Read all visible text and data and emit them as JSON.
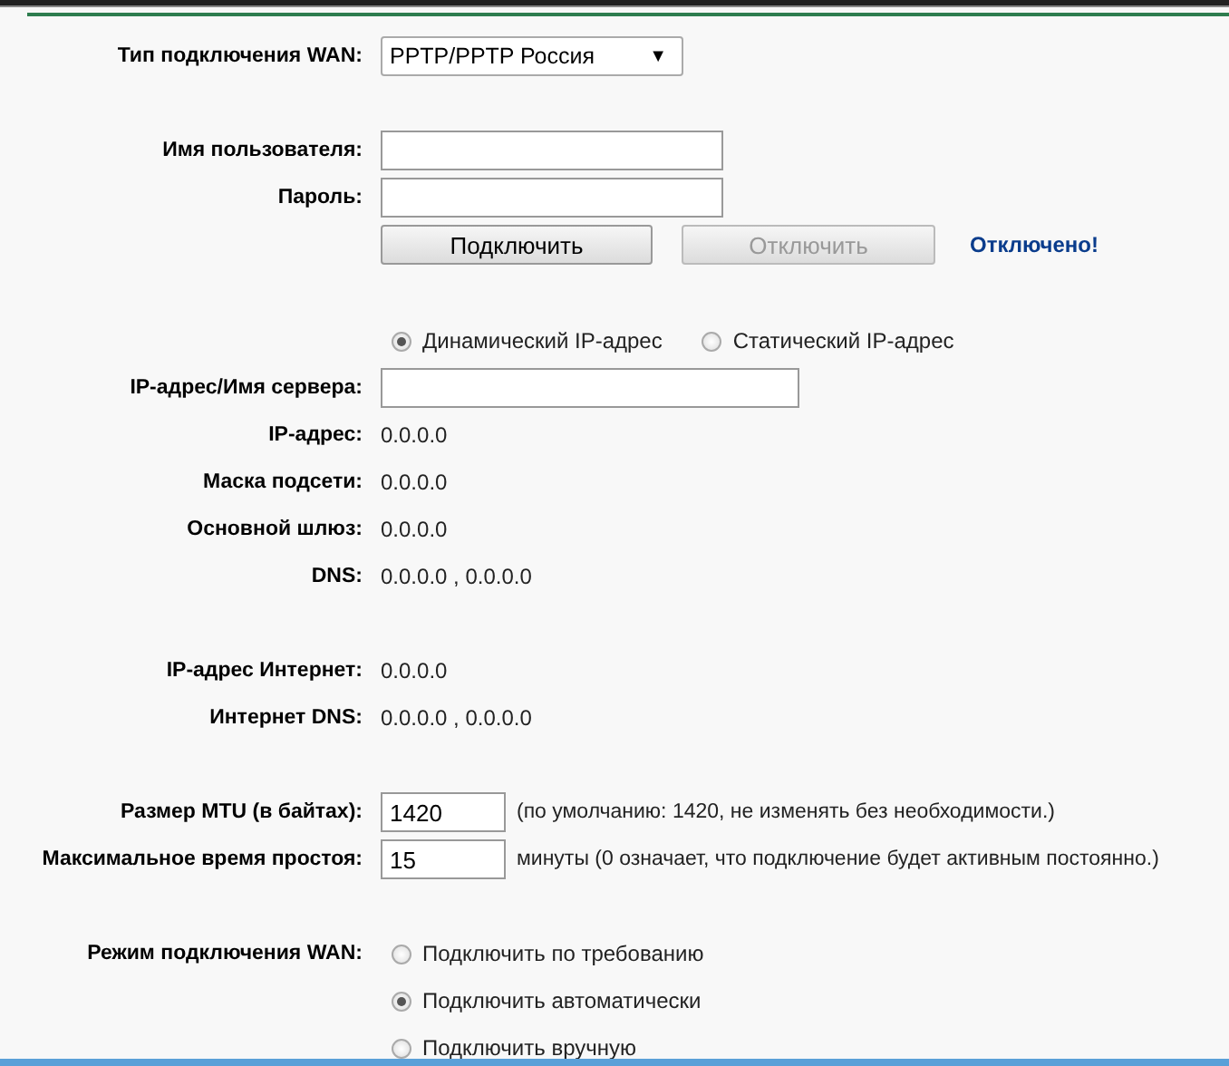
{
  "wan_type": {
    "label": "Тип подключения WAN:",
    "value": "PPTP/PPTP Россия",
    "arrow": "▼"
  },
  "login": {
    "username_label": "Имя пользователя:",
    "password_label": "Пароль:"
  },
  "buttons": [
    {
      "label": "Подключить",
      "disabled": false
    },
    {
      "label": "Отключить",
      "disabled": true
    }
  ],
  "status": "Отключено!",
  "ip_mode": [
    {
      "label": "Динамический IP-адрес",
      "selected": true
    },
    {
      "label": "Статический IP-адрес",
      "selected": false
    }
  ],
  "server": {
    "label": "IP-адрес/Имя сервера:"
  },
  "info": [
    {
      "label": "IP-адрес:",
      "value": "0.0.0.0"
    },
    {
      "label": "Маска подсети:",
      "value": "0.0.0.0"
    },
    {
      "label": "Основной шлюз:",
      "value": "0.0.0.0"
    },
    {
      "label": "DNS:",
      "value": "0.0.0.0 , 0.0.0.0"
    }
  ],
  "internet": [
    {
      "label": "IP-адрес Интернет:",
      "value": "0.0.0.0"
    },
    {
      "label": "Интернет DNS:",
      "value": "0.0.0.0 , 0.0.0.0"
    }
  ],
  "settings": [
    {
      "label": "Размер MTU (в байтах):",
      "value": "1420",
      "note": "(по умолчанию: 1420, не изменять без необходимости.)"
    },
    {
      "label": "Максимальное время простоя:",
      "value": "15",
      "note": "минуты (0 означает, что подключение будет активным постоянно.)"
    }
  ],
  "connection_mode": {
    "label": "Режим подключения WAN:",
    "options": [
      {
        "label": "Подключить по требованию",
        "selected": false
      },
      {
        "label": "Подключить автоматически",
        "selected": true
      },
      {
        "label": "Подключить вручную",
        "selected": false
      }
    ]
  }
}
